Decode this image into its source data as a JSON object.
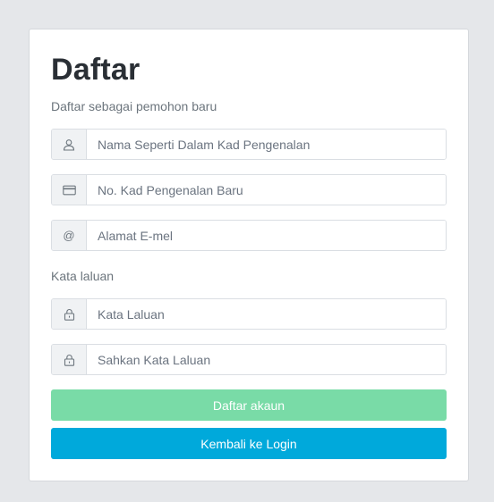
{
  "form": {
    "title": "Daftar",
    "subtitle": "Daftar sebagai pemohon baru",
    "fields": [
      {
        "icon": "user-icon",
        "placeholder": "Nama Seperti Dalam Kad Pengenalan",
        "value": ""
      },
      {
        "icon": "id-card-icon",
        "placeholder": "No. Kad Pengenalan Baru",
        "value": ""
      },
      {
        "icon": "at-icon",
        "placeholder": "Alamat E-mel",
        "value": "",
        "addon_text": "@"
      }
    ],
    "password_section_label": "Kata laluan",
    "password_fields": [
      {
        "icon": "lock-icon",
        "placeholder": "Kata Laluan",
        "value": ""
      },
      {
        "icon": "lock-icon",
        "placeholder": "Sahkan Kata Laluan",
        "value": ""
      }
    ],
    "register_button": "Daftar akaun",
    "back_button": "Kembali ke Login"
  },
  "colors": {
    "background": "#e5e7ea",
    "card": "#ffffff",
    "register_button": "#79dba7",
    "back_button": "#00a9db"
  }
}
